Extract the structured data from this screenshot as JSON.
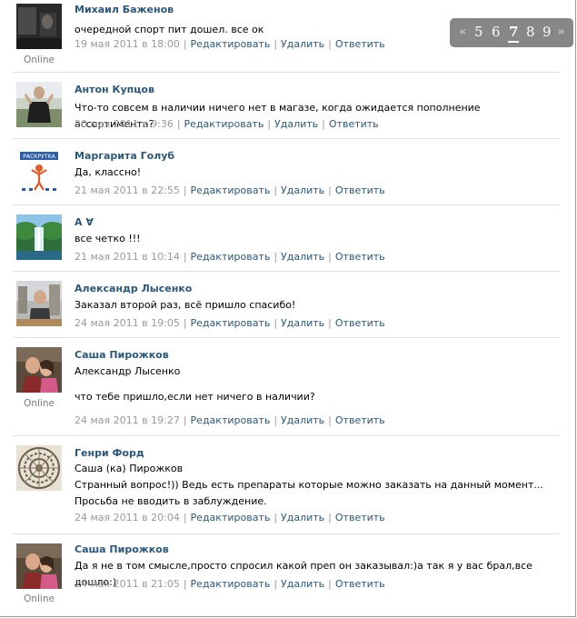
{
  "pager": {
    "prev_glyph": "«",
    "next_glyph": "»",
    "pages": [
      "5",
      "6",
      "7",
      "8",
      "9"
    ],
    "current": "7"
  },
  "actions": {
    "edit": "Редактировать",
    "delete": "Удалить",
    "reply": "Ответить",
    "separator": "|"
  },
  "online_label": "Online",
  "posts": [
    {
      "author": "Михаил Баженов",
      "avatar": "photo-dark-room",
      "online": true,
      "lines": [
        "очередной спорт пит дошел. все ок"
      ],
      "date": "19 мая 2011 в 18:00"
    },
    {
      "author": "Антон Купцов",
      "avatar": "photo-person-outdoors",
      "online": false,
      "lines": [
        "Что-то совсем в наличии ничего нет в магазе, когда ожидается пополнение ассортимента?"
      ],
      "date": "20 мая 2011 в 9:36"
    },
    {
      "author": "Маргарита Голуб",
      "avatar": "logo-raskrutka",
      "avatar_text": "РАСКРУТКА",
      "online": false,
      "lines": [
        "Да, классно!"
      ],
      "date": "21 мая 2011 в 22:55"
    },
    {
      "author": "A ∀",
      "avatar": "photo-waterfall",
      "online": false,
      "lines": [
        "все четко !!!"
      ],
      "date": "21 мая 2011 в 10:14"
    },
    {
      "author": "Александр Лысенко",
      "avatar": "photo-man-city",
      "online": false,
      "lines": [
        "Заказал второй раз, всё пришло спасибо!"
      ],
      "date": "24 мая 2011 в 19:05"
    },
    {
      "author": "Саша Пирожков",
      "avatar": "photo-couple",
      "online": true,
      "lines": [
        "Александр Лысенко",
        "что тебе пришло,если нет ничего в наличии?"
      ],
      "date": "24 мая 2011 в 19:27"
    },
    {
      "author": "Генри Форд",
      "avatar": "pattern-mandala",
      "online": false,
      "lines": [
        "Саша (ка) Пирожков",
        "Странный вопрос!)) Ведь есть препараты которые можно заказать на данный момент... Просьба не вводить в заблуждение."
      ],
      "date": "24 мая 2011 в 20:04"
    },
    {
      "author": "Саша Пирожков",
      "avatar": "photo-couple",
      "online": true,
      "lines": [
        "Да я не в том смысле,просто спросил какой преп он заказывал:)а так я у вас брал,все дошло:)"
      ],
      "date": "24 мая 2011 в 21:05"
    }
  ]
}
